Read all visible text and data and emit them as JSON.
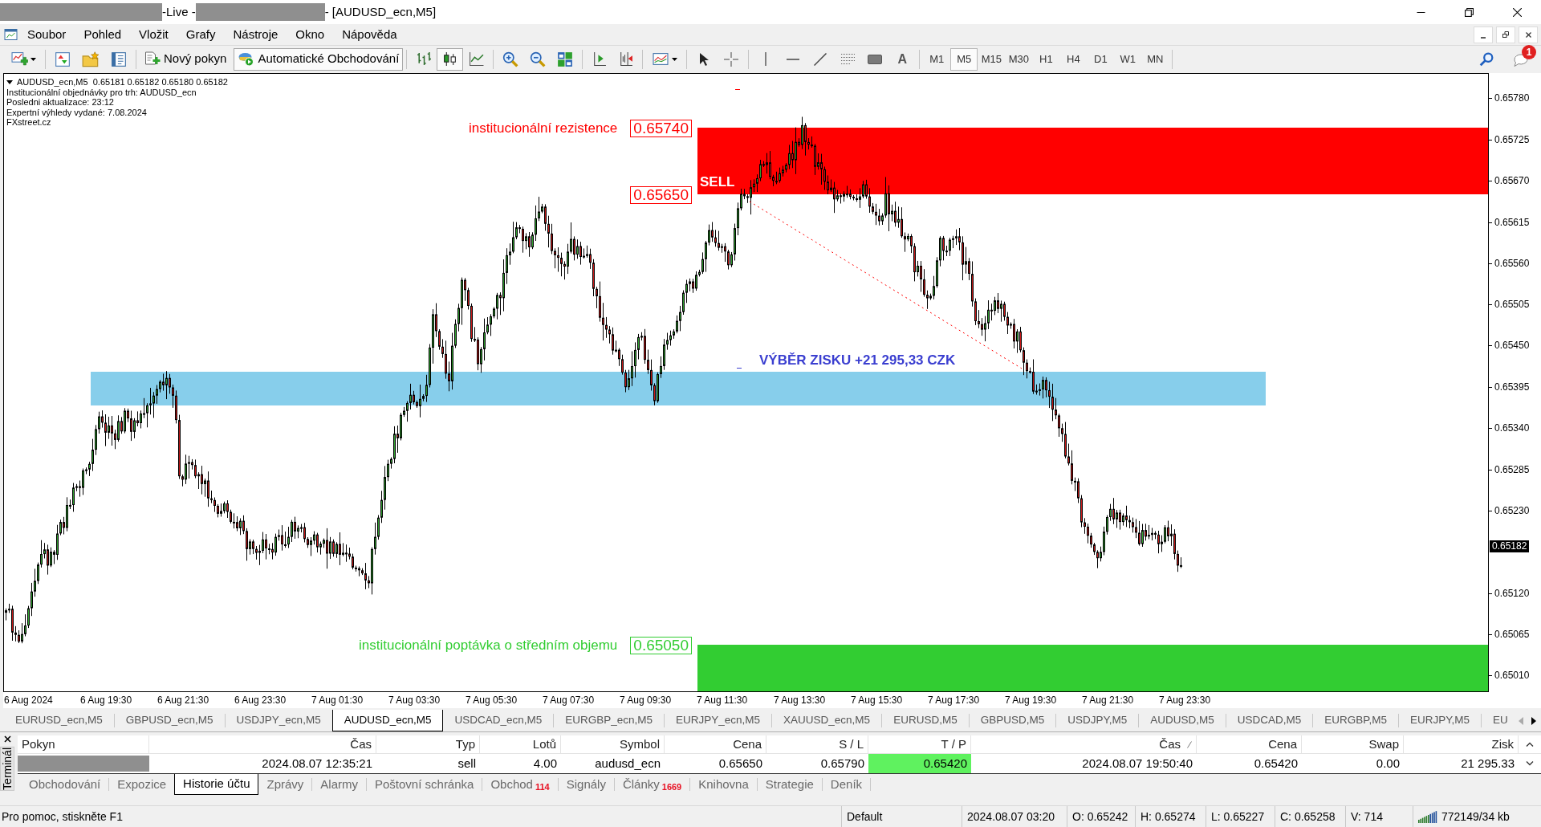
{
  "window": {
    "title_parts": [
      {
        "kind": "redacted"
      },
      {
        "kind": "text",
        "text": "-Live -"
      },
      {
        "kind": "redacted"
      },
      {
        "kind": "text",
        "text": "- [AUDUSD_ecn,M5]"
      }
    ]
  },
  "menu": [
    "Soubor",
    "Pohled",
    "Vložit",
    "Grafy",
    "Nástroje",
    "Okno",
    "Nápověda"
  ],
  "toolbar": {
    "order_buttons": [
      {
        "label": "Nový pokyn",
        "pressed": false
      },
      {
        "label": "Automatické Obchodování",
        "pressed": true
      }
    ],
    "chart_types": [
      {
        "kind": "bars",
        "selected": false
      },
      {
        "kind": "candles",
        "selected": true
      },
      {
        "kind": "line",
        "selected": false
      }
    ],
    "text_tool": "A",
    "timeframes": [
      {
        "label": "M1",
        "selected": false
      },
      {
        "label": "M5",
        "selected": true
      },
      {
        "label": "M15",
        "selected": false
      },
      {
        "label": "M30",
        "selected": false
      },
      {
        "label": "H1",
        "selected": false
      },
      {
        "label": "H4",
        "selected": false
      },
      {
        "label": "D1",
        "selected": false
      },
      {
        "label": "W1",
        "selected": false
      },
      {
        "label": "MN",
        "selected": false
      }
    ],
    "notification_count": "1"
  },
  "chart": {
    "info_header": "AUDUSD_ecn,M5  0.65181 0.65182 0.65180 0.65182",
    "info_lines": [
      "Institucionální objednávky pro trh: AUDUSD_ecn",
      "Posledni aktualizace: 23:12",
      "Expertní výhledy vydané: 7.08.2024",
      "FXstreet.cz"
    ],
    "zones": [
      {
        "kind": "resistance",
        "color": "#ff0000",
        "label": "institucionální rezistence",
        "prices": [
          "0.65740",
          "0.65650"
        ]
      },
      {
        "kind": "band",
        "color": "#87ceeb"
      },
      {
        "kind": "demand",
        "color": "#32cd32",
        "label": "institucionální poptávka o středním objemu",
        "prices": [
          "0.65050"
        ]
      }
    ],
    "annotations": [
      {
        "kind": "sell",
        "text": "SELL"
      },
      {
        "kind": "profit",
        "text": "VÝBĚR ZISKU +21 295,33 CZK"
      }
    ],
    "price_axis": [
      "0.65780",
      "0.65725",
      "0.65670",
      "0.65615",
      "0.65560",
      "0.65505",
      "0.65450",
      "0.65395",
      "0.65340",
      "0.65285",
      "0.65230",
      "0.65120",
      "0.65065",
      "0.65010"
    ],
    "current_price": "0.65182",
    "time_axis": [
      "6 Aug 2024",
      "6 Aug 19:30",
      "6 Aug 21:30",
      "6 Aug 23:30",
      "7 Aug 01:30",
      "7 Aug 03:30",
      "7 Aug 05:30",
      "7 Aug 07:30",
      "7 Aug 09:30",
      "7 Aug 11:30",
      "7 Aug 13:30",
      "7 Aug 15:30",
      "7 Aug 17:30",
      "7 Aug 19:30",
      "7 Aug 21:30",
      "7 Aug 23:30"
    ]
  },
  "chart_tabs": [
    {
      "label": "EURUSD_ecn,M5",
      "selected": false
    },
    {
      "label": "GBPUSD_ecn,M5",
      "selected": false
    },
    {
      "label": "USDJPY_ecn,M5",
      "selected": false
    },
    {
      "label": "AUDUSD_ecn,M5",
      "selected": true
    },
    {
      "label": "USDCAD_ecn,M5",
      "selected": false
    },
    {
      "label": "EURGBP_ecn,M5",
      "selected": false
    },
    {
      "label": "EURJPY_ecn,M5",
      "selected": false
    },
    {
      "label": "XAUUSD_ecn,M5",
      "selected": false
    },
    {
      "label": "EURUSD,M5",
      "selected": false
    },
    {
      "label": "GBPUSD,M5",
      "selected": false
    },
    {
      "label": "USDJPY,M5",
      "selected": false
    },
    {
      "label": "AUDUSD,M5",
      "selected": false
    },
    {
      "label": "USDCAD,M5",
      "selected": false
    },
    {
      "label": "EURGBP,M5",
      "selected": false
    },
    {
      "label": "EURJPY,M5",
      "selected": false
    },
    {
      "label": "EU",
      "selected": false
    }
  ],
  "terminal": {
    "title": "Terminál",
    "columns": [
      {
        "label": "Pokyn",
        "sorted": false
      },
      {
        "label": "Čas",
        "sorted": false
      },
      {
        "label": "Typ",
        "sorted": false
      },
      {
        "label": "Lotů",
        "sorted": false
      },
      {
        "label": "Symbol",
        "sorted": false
      },
      {
        "label": "Cena",
        "sorted": false
      },
      {
        "label": "S / L",
        "sorted": false
      },
      {
        "label": "T / P",
        "sorted": false
      },
      {
        "label": "Čas",
        "sorted": true
      },
      {
        "label": "Cena",
        "sorted": false
      },
      {
        "label": "Swap",
        "sorted": false
      },
      {
        "label": "Zisk",
        "sorted": false
      }
    ],
    "rows": [
      {
        "cells": [
          {
            "kind": "redacted"
          },
          {
            "kind": "text",
            "text": "2024.08.07 12:35:21",
            "highlighted": false
          },
          {
            "kind": "text",
            "text": "sell",
            "highlighted": false
          },
          {
            "kind": "text",
            "text": "4.00",
            "highlighted": false
          },
          {
            "kind": "text",
            "text": "audusd_ecn",
            "highlighted": false
          },
          {
            "kind": "text",
            "text": "0.65650",
            "highlighted": false
          },
          {
            "kind": "text",
            "text": "0.65790",
            "highlighted": false
          },
          {
            "kind": "text",
            "text": "0.65420",
            "highlighted": true
          },
          {
            "kind": "text",
            "text": "2024.08.07 19:50:40",
            "highlighted": false
          },
          {
            "kind": "text",
            "text": "0.65420",
            "highlighted": false
          },
          {
            "kind": "text",
            "text": "0.00",
            "highlighted": false
          },
          {
            "kind": "text",
            "text": "21 295.33",
            "highlighted": false
          }
        ]
      }
    ],
    "tabs": [
      {
        "label": "Obchodování",
        "selected": false
      },
      {
        "label": "Expozice",
        "selected": false
      },
      {
        "label": "Historie účtu",
        "selected": true
      },
      {
        "label": "Zprávy",
        "selected": false
      },
      {
        "label": "Alarmy",
        "selected": false
      },
      {
        "label": "Poštovní schránka",
        "selected": false
      },
      {
        "label": "Obchod",
        "badge": "114",
        "selected": false
      },
      {
        "label": "Signály",
        "selected": false
      },
      {
        "label": "Články",
        "badge": "1669",
        "selected": false
      },
      {
        "label": "Knihovna",
        "selected": false
      },
      {
        "label": "Strategie",
        "selected": false
      },
      {
        "label": "Deník",
        "selected": false
      }
    ]
  },
  "status_bar": {
    "help": "Pro pomoc, stiskněte F1",
    "sections": [
      "Default",
      "2024.08.07 03:20",
      "O: 0.65242",
      "H: 0.65274",
      "L: 0.65227",
      "C: 0.65258",
      "V: 714"
    ],
    "traffic": "772149/34 kb"
  }
}
